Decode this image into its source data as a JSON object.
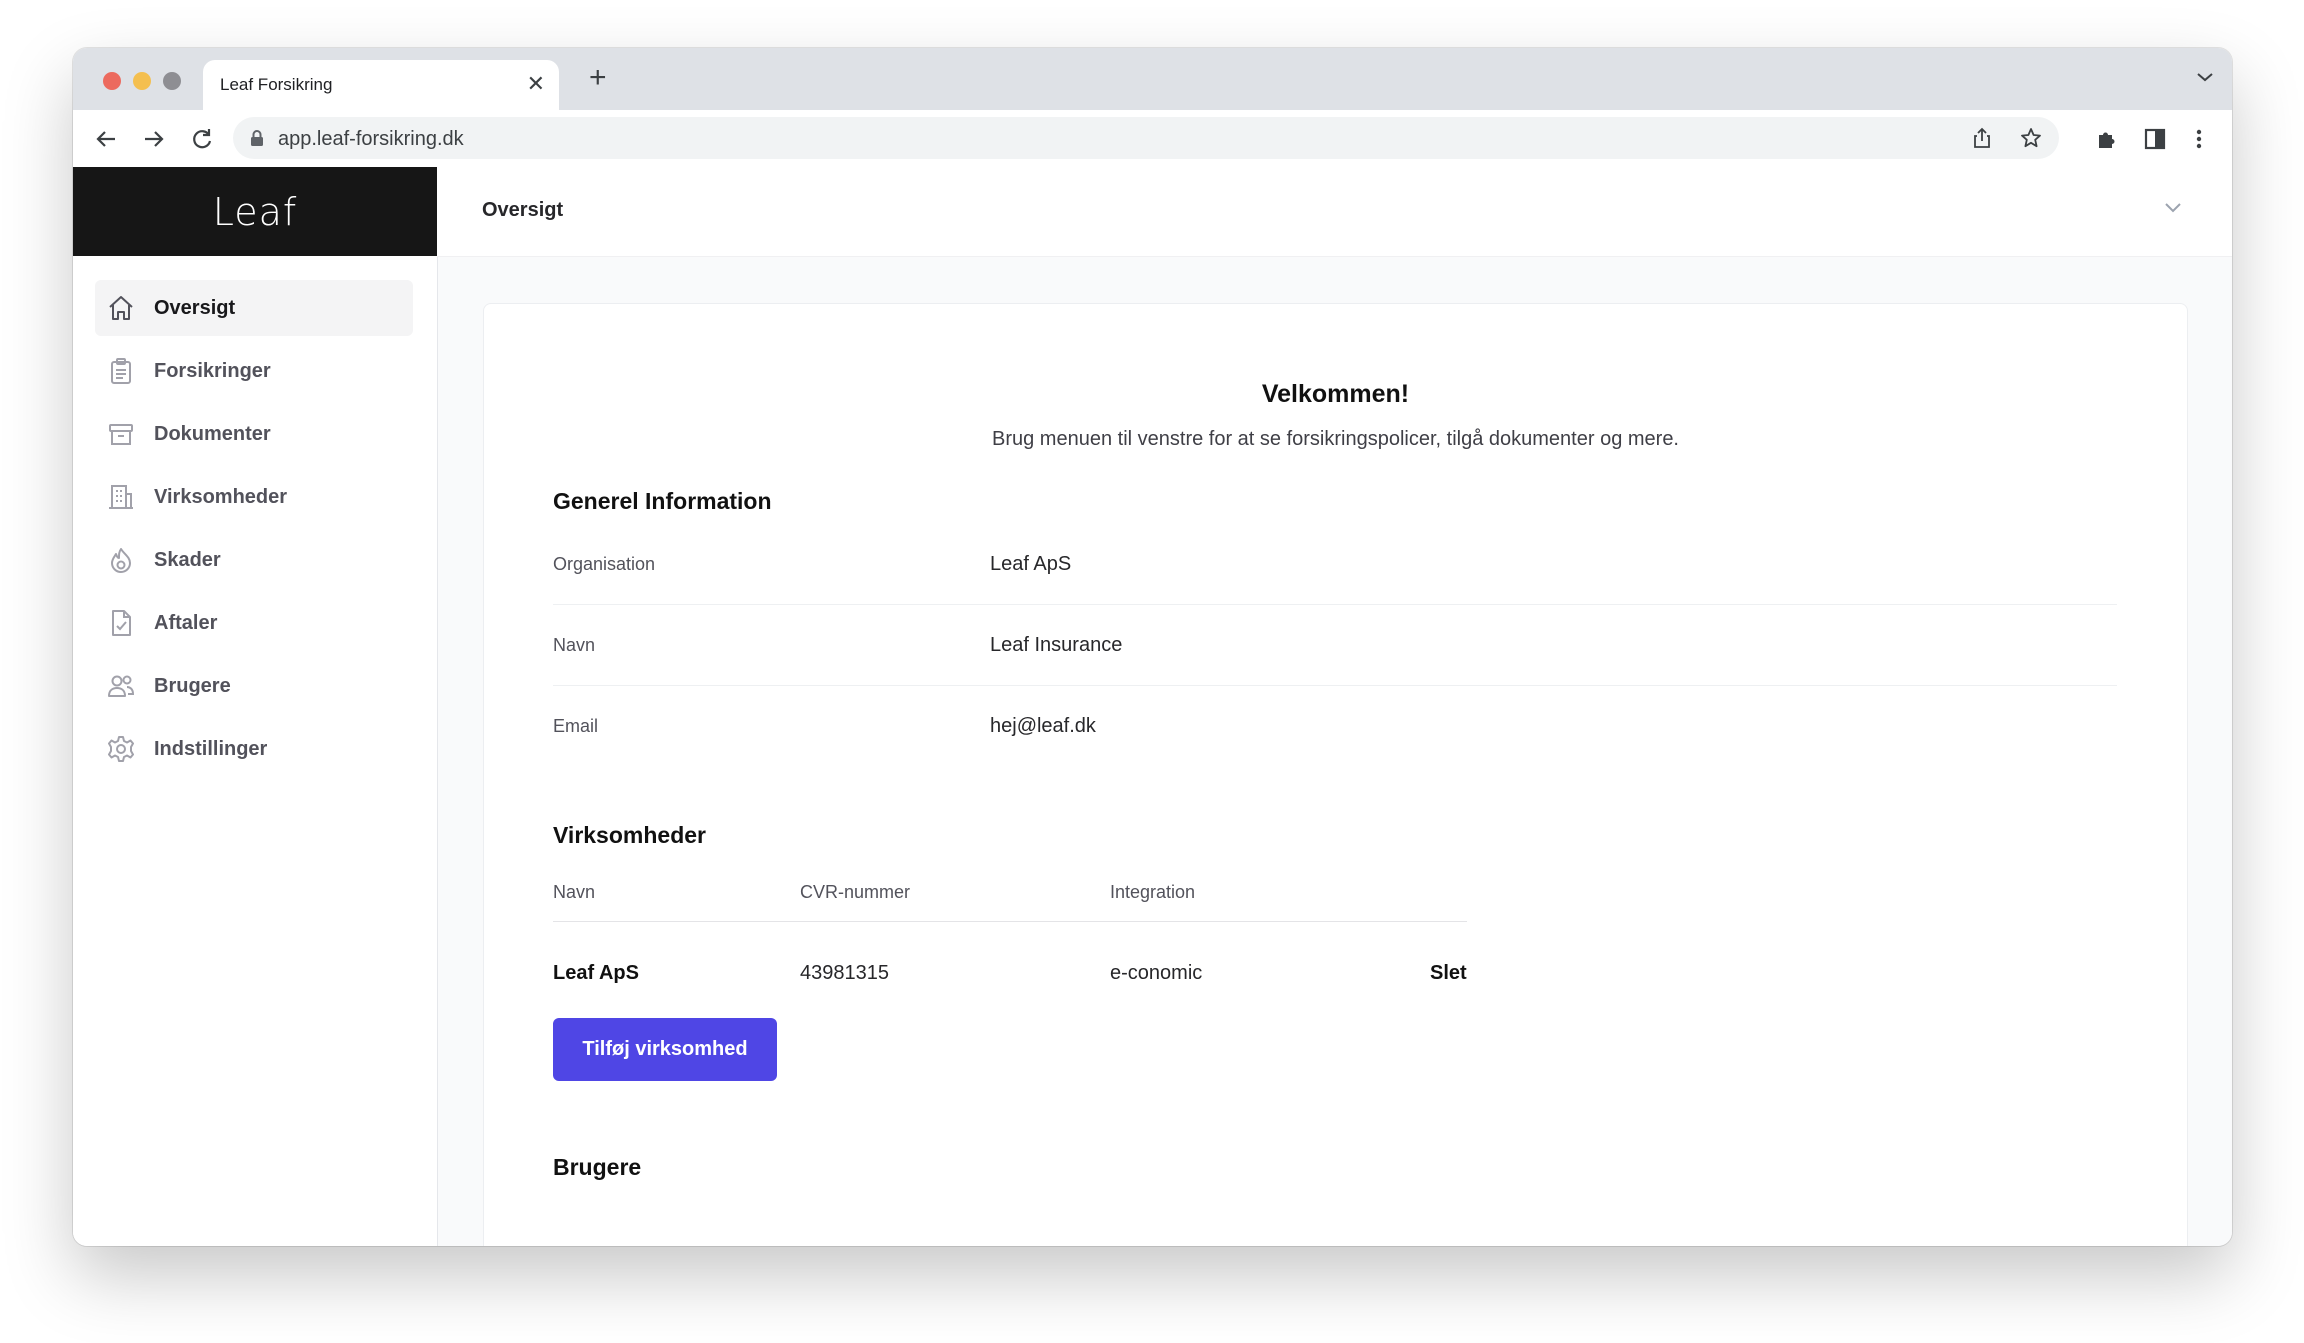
{
  "browser": {
    "tab_title": "Leaf Forsikring",
    "url": "app.leaf-forsikring.dk"
  },
  "app": {
    "logo": "Leaf",
    "page_title": "Oversigt"
  },
  "sidebar": {
    "items": [
      {
        "label": "Oversigt",
        "icon": "home-icon",
        "active": true
      },
      {
        "label": "Forsikringer",
        "icon": "clipboard-icon",
        "active": false
      },
      {
        "label": "Dokumenter",
        "icon": "archive-icon",
        "active": false
      },
      {
        "label": "Virksomheder",
        "icon": "building-icon",
        "active": false
      },
      {
        "label": "Skader",
        "icon": "fire-icon",
        "active": false
      },
      {
        "label": "Aftaler",
        "icon": "document-check-icon",
        "active": false
      },
      {
        "label": "Brugere",
        "icon": "users-icon",
        "active": false
      },
      {
        "label": "Indstillinger",
        "icon": "gear-icon",
        "active": false
      }
    ]
  },
  "welcome": {
    "title": "Velkommen!",
    "subtitle": "Brug menuen til venstre for at se forsikringspolicer, tilgå dokumenter og mere."
  },
  "general": {
    "title": "Generel Information",
    "rows": [
      {
        "label": "Organisation",
        "value": "Leaf ApS"
      },
      {
        "label": "Navn",
        "value": "Leaf Insurance"
      },
      {
        "label": "Email",
        "value": "hej@leaf.dk"
      }
    ]
  },
  "companies": {
    "title": "Virksomheder",
    "columns": [
      "Navn",
      "CVR-nummer",
      "Integration"
    ],
    "rows": [
      {
        "name": "Leaf ApS",
        "cvr": "43981315",
        "integration": "e-conomic",
        "action": "Slet"
      }
    ],
    "add_button": "Tilføj virksomhed"
  },
  "users": {
    "title": "Brugere"
  },
  "colors": {
    "brand_dark": "#161616",
    "accent": "#4f46e5",
    "active_nav_bg": "#f4f4f5"
  }
}
